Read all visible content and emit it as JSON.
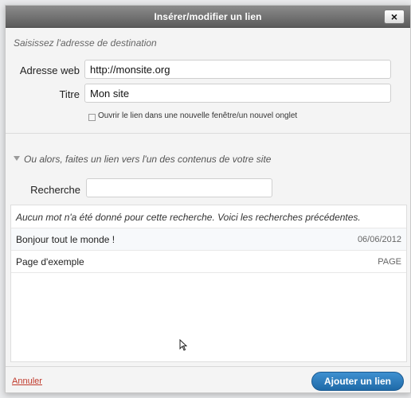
{
  "dialog": {
    "title": "Insérer/modifier un lien",
    "close_symbol": "×",
    "close_icon": "close-icon"
  },
  "destination": {
    "hint": "Saisissez l'adresse de destination",
    "url_label": "Adresse web",
    "url_value": "http://monsite.org",
    "title_label": "Titre",
    "title_value": "Mon site",
    "new_tab_label": "Ouvrir le lien dans une nouvelle fenêtre/un nouvel onglet",
    "new_tab_checked": false
  },
  "internal": {
    "toggle_text": "Ou alors, faites un lien vers l'un des contenus de votre site",
    "search_label": "Recherche",
    "search_value": "",
    "results_message": "Aucun mot n'a été donné pour cette recherche. Voici les recherches précédentes.",
    "results": [
      {
        "title": "Bonjour tout le monde !",
        "meta": "06/06/2012"
      },
      {
        "title": "Page d'exemple",
        "meta": "PAGE"
      }
    ]
  },
  "footer": {
    "cancel_label": "Annuler",
    "submit_label": "Ajouter un lien"
  },
  "colors": {
    "title_bar": "#6f6f6f",
    "primary_button": "#2a7bbd",
    "cancel_link": "#c0392b"
  }
}
